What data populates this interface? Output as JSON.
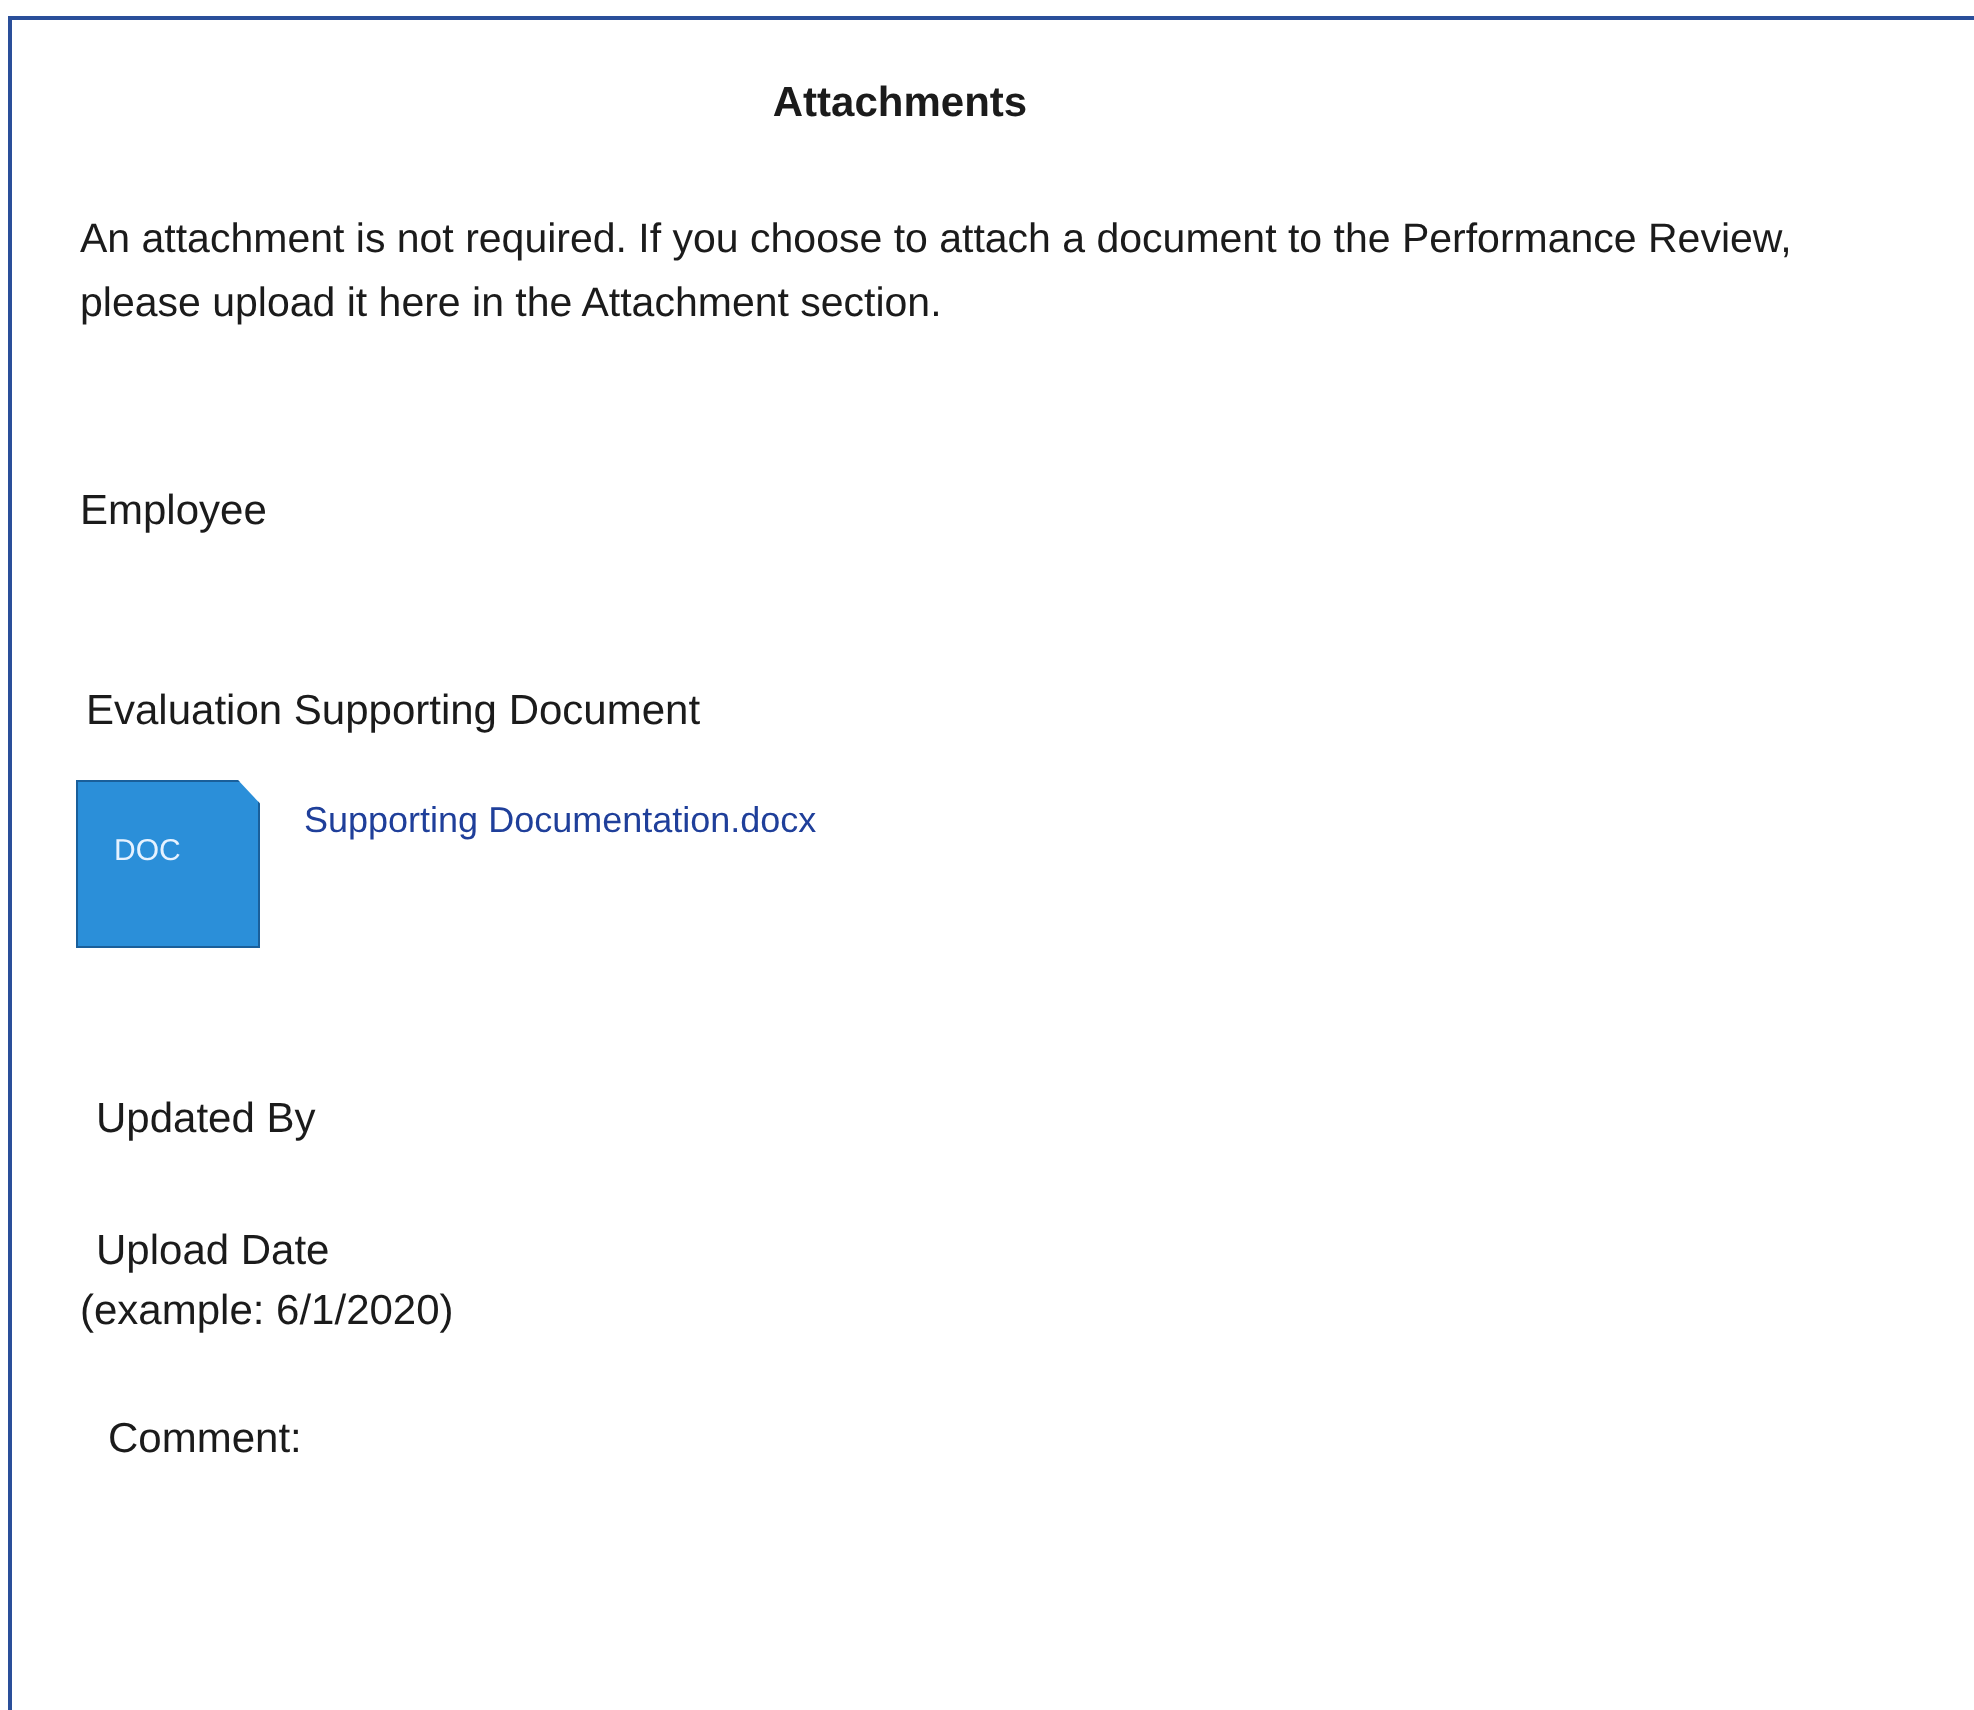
{
  "section": {
    "title": "Attachments",
    "intro": "An attachment is not required. If you choose to attach a document to the Performance Review, please upload it here in the Attachment section."
  },
  "fields": [
    {
      "kind": "label",
      "label": "Employee"
    },
    {
      "kind": "attachment",
      "label": "Evaluation Supporting Document",
      "file_type": "DOC",
      "file_name": "Supporting Documentation.docx"
    },
    {
      "kind": "label",
      "label": "Updated By"
    },
    {
      "kind": "date",
      "label": "Upload Date",
      "hint": "(example:  6/1/2020)"
    },
    {
      "kind": "label",
      "label": "Comment:"
    }
  ]
}
